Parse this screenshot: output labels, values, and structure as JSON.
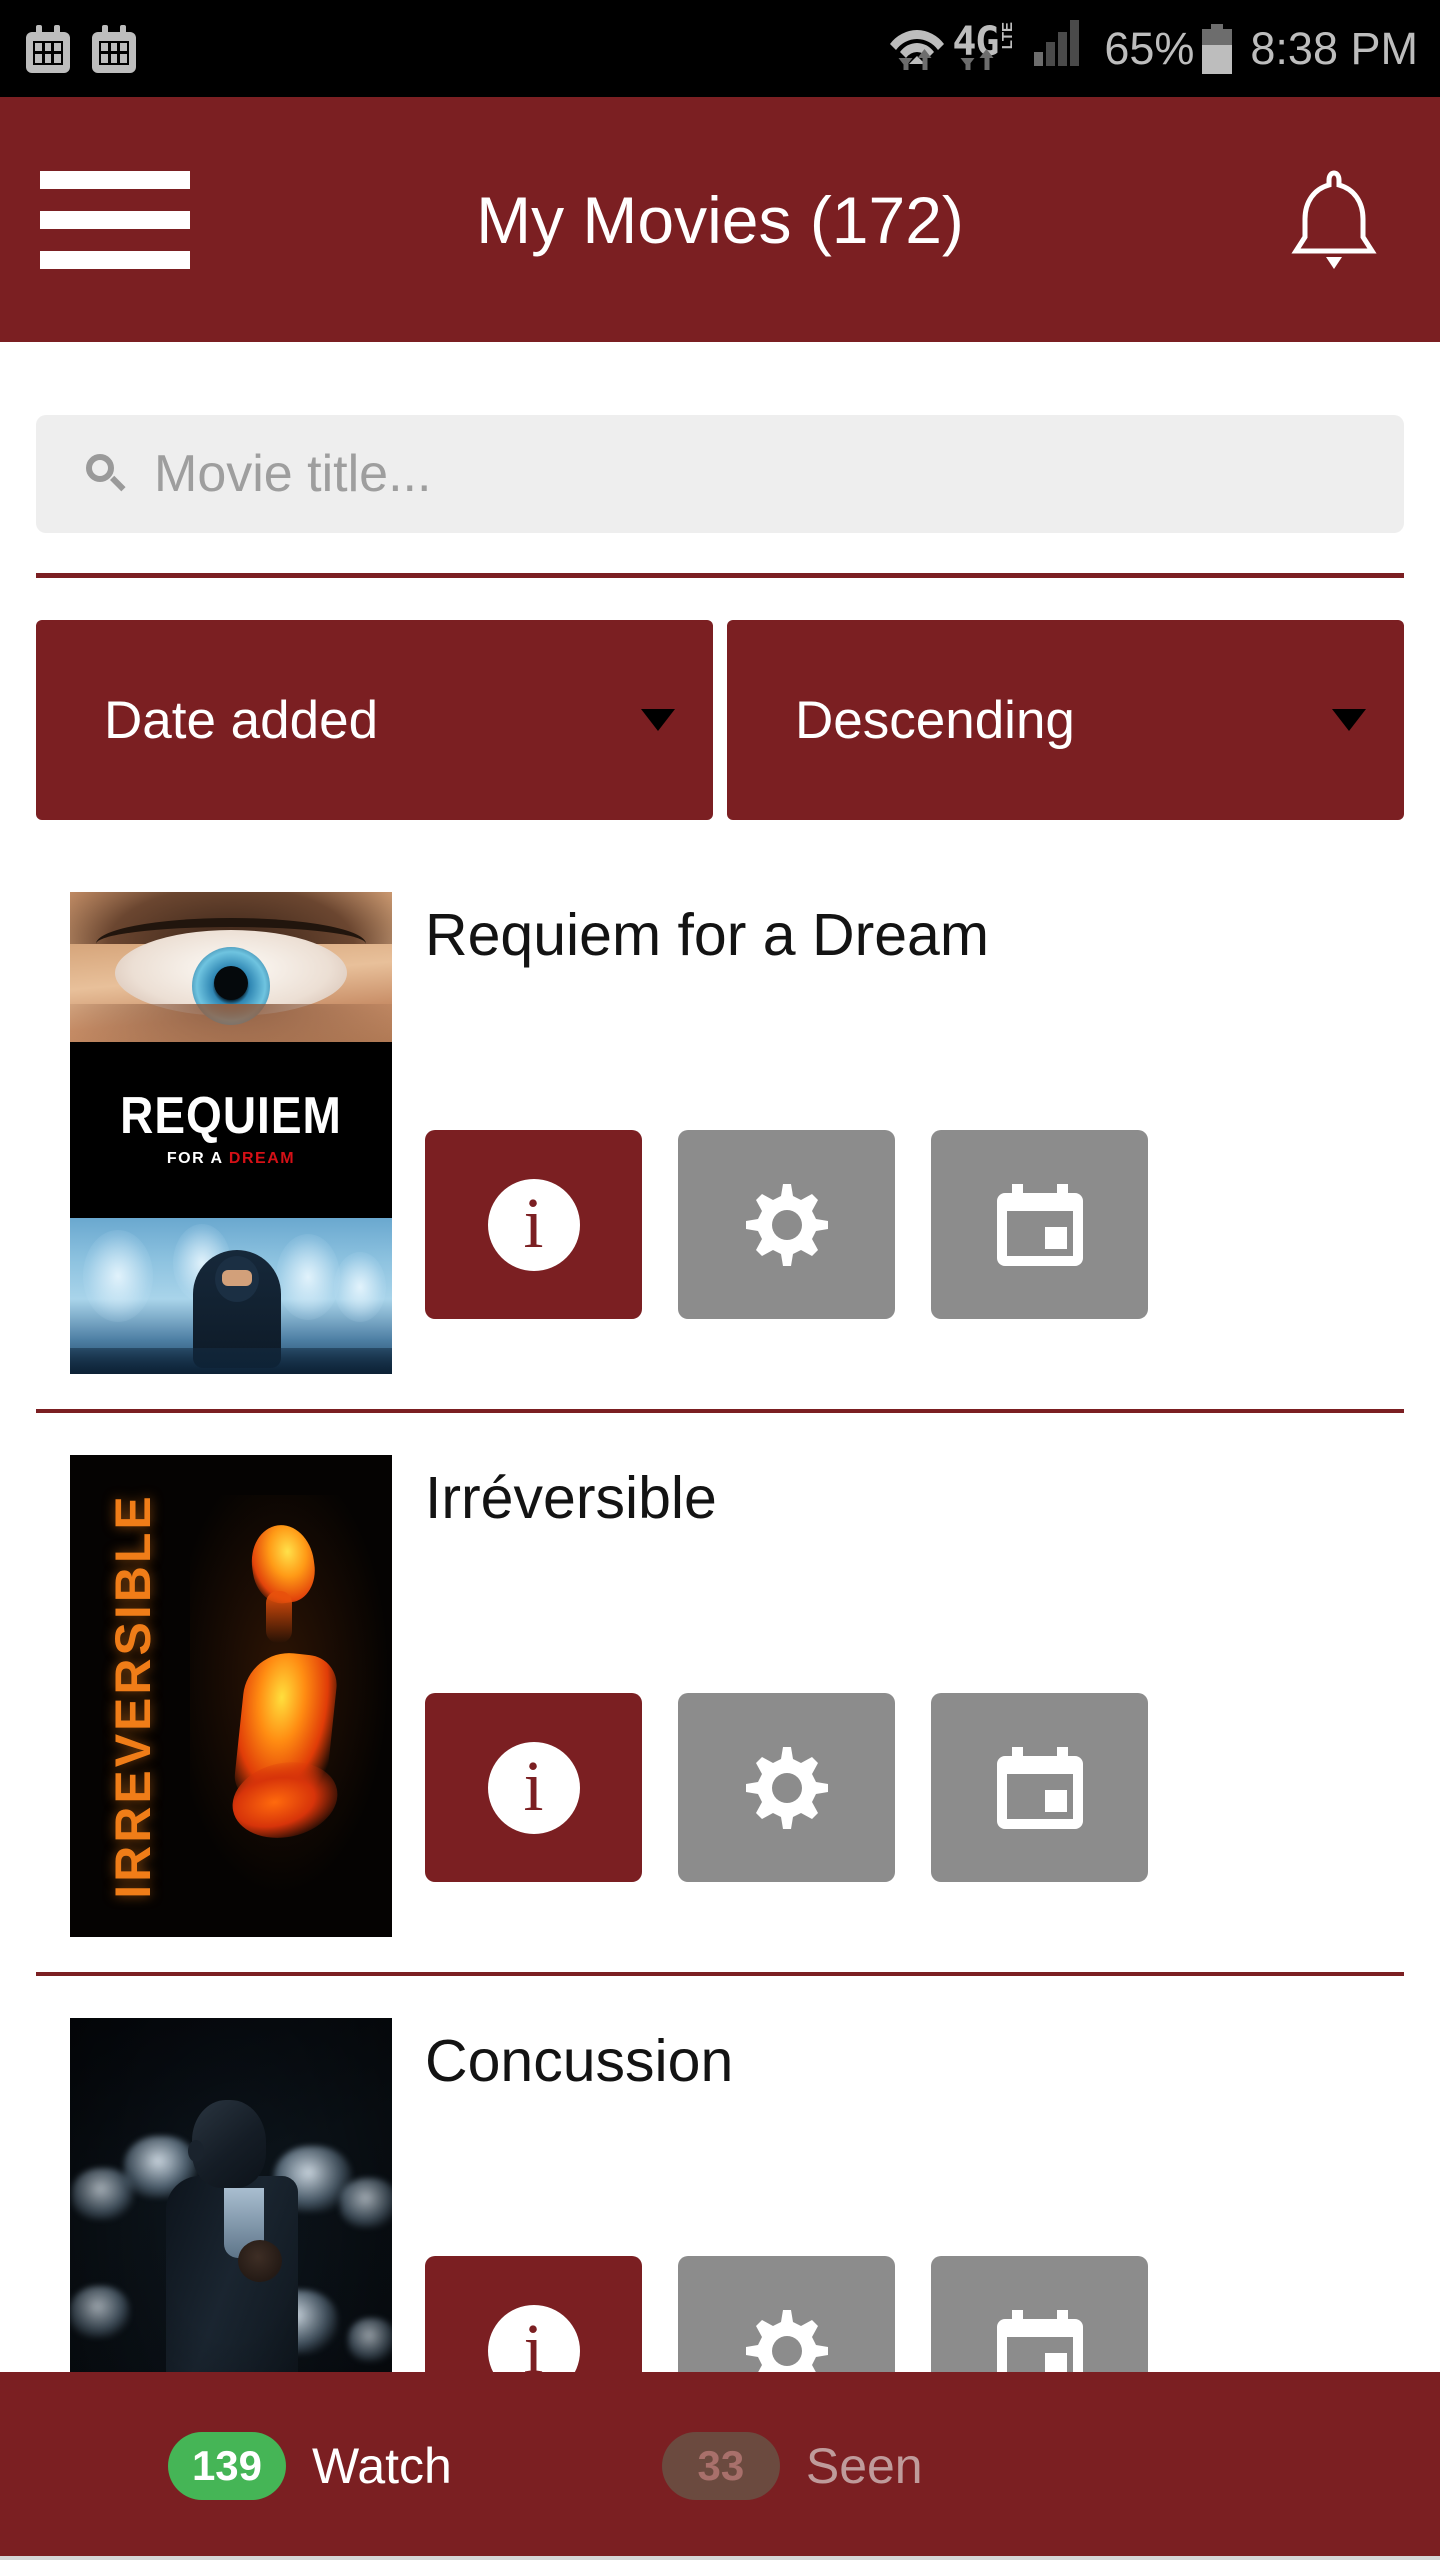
{
  "status_bar": {
    "notification_icons": [
      "calendar-icon",
      "calendar-icon"
    ],
    "wifi_icon": "wifi-icon",
    "network_label": "4G",
    "network_sup": "LTE",
    "signal_icon": "signal-bars-icon",
    "battery_percent": "65%",
    "battery_icon": "battery-icon",
    "time": "8:38 PM"
  },
  "app_bar": {
    "menu_icon": "hamburger-menu-icon",
    "title": "My Movies (172)",
    "notification_icon": "bell-icon"
  },
  "search": {
    "icon": "search-icon",
    "placeholder": "Movie title...",
    "value": ""
  },
  "filters": {
    "sort_by": {
      "label": "Date added",
      "caret": "chevron-down-icon"
    },
    "sort_order": {
      "label": "Descending",
      "caret": "chevron-down-icon"
    }
  },
  "movies": [
    {
      "title": "Requiem for a Dream",
      "poster_text_main": "REQUIEM",
      "poster_text_sub_white": "FOR A ",
      "poster_text_sub_red": "DREAM",
      "actions": [
        {
          "name": "info-button",
          "icon": "info-icon",
          "style": "primary"
        },
        {
          "name": "settings-button",
          "icon": "gear-icon",
          "style": "neutral"
        },
        {
          "name": "calendar-button",
          "icon": "calendar-icon",
          "style": "neutral"
        }
      ]
    },
    {
      "title": "Irréversible",
      "poster_text_main": "IRREVERSIBLE",
      "actions": [
        {
          "name": "info-button",
          "icon": "info-icon",
          "style": "primary"
        },
        {
          "name": "settings-button",
          "icon": "gear-icon",
          "style": "neutral"
        },
        {
          "name": "calendar-button",
          "icon": "calendar-icon",
          "style": "neutral"
        }
      ]
    },
    {
      "title": "Concussion",
      "poster_text_main": "",
      "actions": [
        {
          "name": "info-button",
          "icon": "info-icon",
          "style": "primary"
        },
        {
          "name": "settings-button",
          "icon": "gear-icon",
          "style": "neutral"
        },
        {
          "name": "calendar-button",
          "icon": "calendar-icon",
          "style": "neutral"
        }
      ]
    }
  ],
  "bottom_bar": {
    "watch": {
      "count": "139",
      "label": "Watch",
      "active": true
    },
    "seen": {
      "count": "33",
      "label": "Seen",
      "active": false
    }
  },
  "colors": {
    "brand": "#7B1F22",
    "neutral_button": "#8C8C8C",
    "badge_active": "#45b556",
    "badge_inactive": "#6b4a3f",
    "status_bar_bg": "#000000",
    "search_bg": "#eeeeee"
  }
}
